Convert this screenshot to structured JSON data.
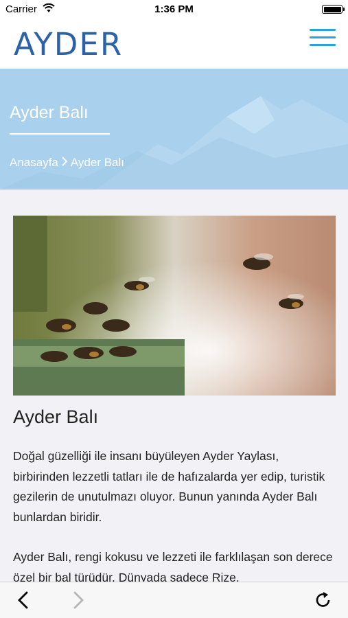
{
  "status_bar": {
    "carrier": "Carrier",
    "time": "1:36 PM"
  },
  "header": {
    "logo": "AYDER",
    "menu_icon": "hamburger-menu-icon"
  },
  "hero": {
    "title": "Ayder Balı",
    "breadcrumb": {
      "home": "Anasayfa",
      "separator_icon": "chevron-right-icon",
      "current": "Ayder Balı"
    }
  },
  "article": {
    "image_alt": "bees",
    "title": "Ayder Balı",
    "paragraphs": [
      "Doğal güzelliği ile insanı büyüleyen Ayder Yaylası, birbirinden lezzetli tatları ile de hafızalarda yer edip, turistik gezilerin de unutulmazı oluyor. Bunun yanında Ayder Balı bunlardan biridir.",
      "Ayder Balı, rengi kokusu ve lezzeti ile farklılaşan son derece özel bir bal türüdür. Dünyada sadece Rize,"
    ]
  },
  "toolbar": {
    "back_icon": "back-arrow-icon",
    "forward_icon": "forward-arrow-icon",
    "reload_icon": "reload-icon"
  },
  "colors": {
    "brand": "#2c63a8",
    "accent": "#29a3dc",
    "hero_bg": "#a9d0ec",
    "content_bg": "#f2f1f6"
  }
}
